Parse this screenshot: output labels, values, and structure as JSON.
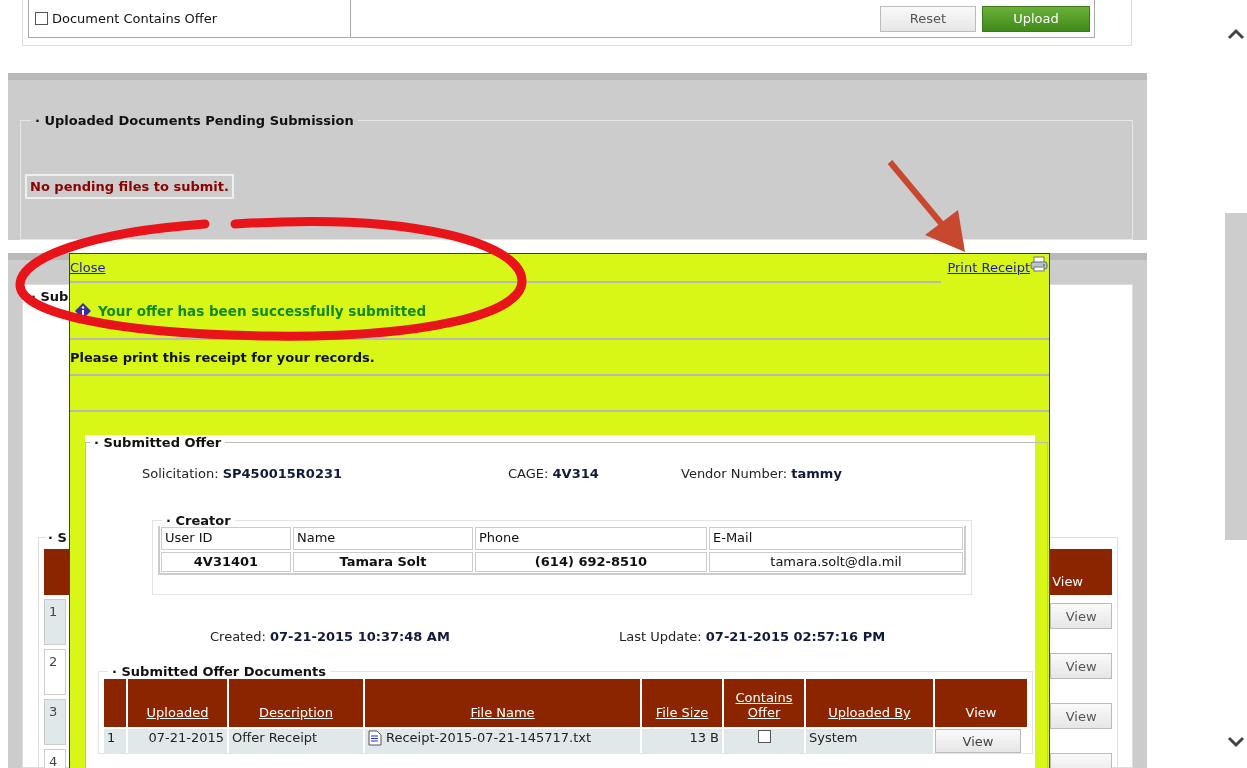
{
  "upload_form": {
    "contains_offer": {
      "label": "Document Contains Offer",
      "checked": false
    },
    "buttons": [
      {
        "label": "Reset",
        "kind": "secondary"
      },
      {
        "label": "Upload",
        "kind": "primary"
      }
    ]
  },
  "pending": {
    "legend": "· Uploaded Documents Pending Submission",
    "message": "No pending files to submit."
  },
  "submitted": {
    "legend": "· Sub",
    "table_legend": "· S",
    "view_header": "View",
    "rows": [
      {
        "number": "1",
        "view": "View"
      },
      {
        "number": "2",
        "view": "View"
      },
      {
        "number": "3",
        "view": "View"
      },
      {
        "number": "4"
      }
    ]
  },
  "receipt": {
    "close": "Close",
    "print": "Print Receipt",
    "message": "Your offer has been successfully submitted",
    "instruction": "Please print this receipt for your records.",
    "offer": {
      "legend": "· Submitted Offer",
      "fields": [
        {
          "label": "Solicitation:",
          "value": "SP450015R0231"
        },
        {
          "label": "CAGE:",
          "value": "4V314"
        },
        {
          "label": "Vendor Number:",
          "value": "tammy"
        }
      ],
      "creator": {
        "legend": "· Creator",
        "columns": [
          "User ID",
          "Name",
          "Phone",
          "E-Mail"
        ],
        "values": [
          "4V31401",
          "Tamara Solt",
          "(614) 692-8510",
          "tamara.solt@dla.mil"
        ]
      },
      "dates": [
        {
          "label": "Created:",
          "value": "07-21-2015 10:37:48 AM"
        },
        {
          "label": "Last Update:",
          "value": "07-21-2015 02:57:16 PM"
        }
      ],
      "documents": {
        "legend": "· Submitted Offer Documents",
        "columns": [
          "Uploaded",
          "Description",
          "File Name",
          "File Size",
          "Contains Offer",
          "Uploaded By",
          "View"
        ],
        "rows": [
          {
            "number": "1",
            "uploaded": "07-21-2015",
            "description": "Offer Receipt",
            "file_name": "Receipt-2015-07-21-145717.txt",
            "file_size": "13 B",
            "contains_offer": false,
            "uploaded_by": "System",
            "view": "View"
          }
        ]
      }
    }
  }
}
